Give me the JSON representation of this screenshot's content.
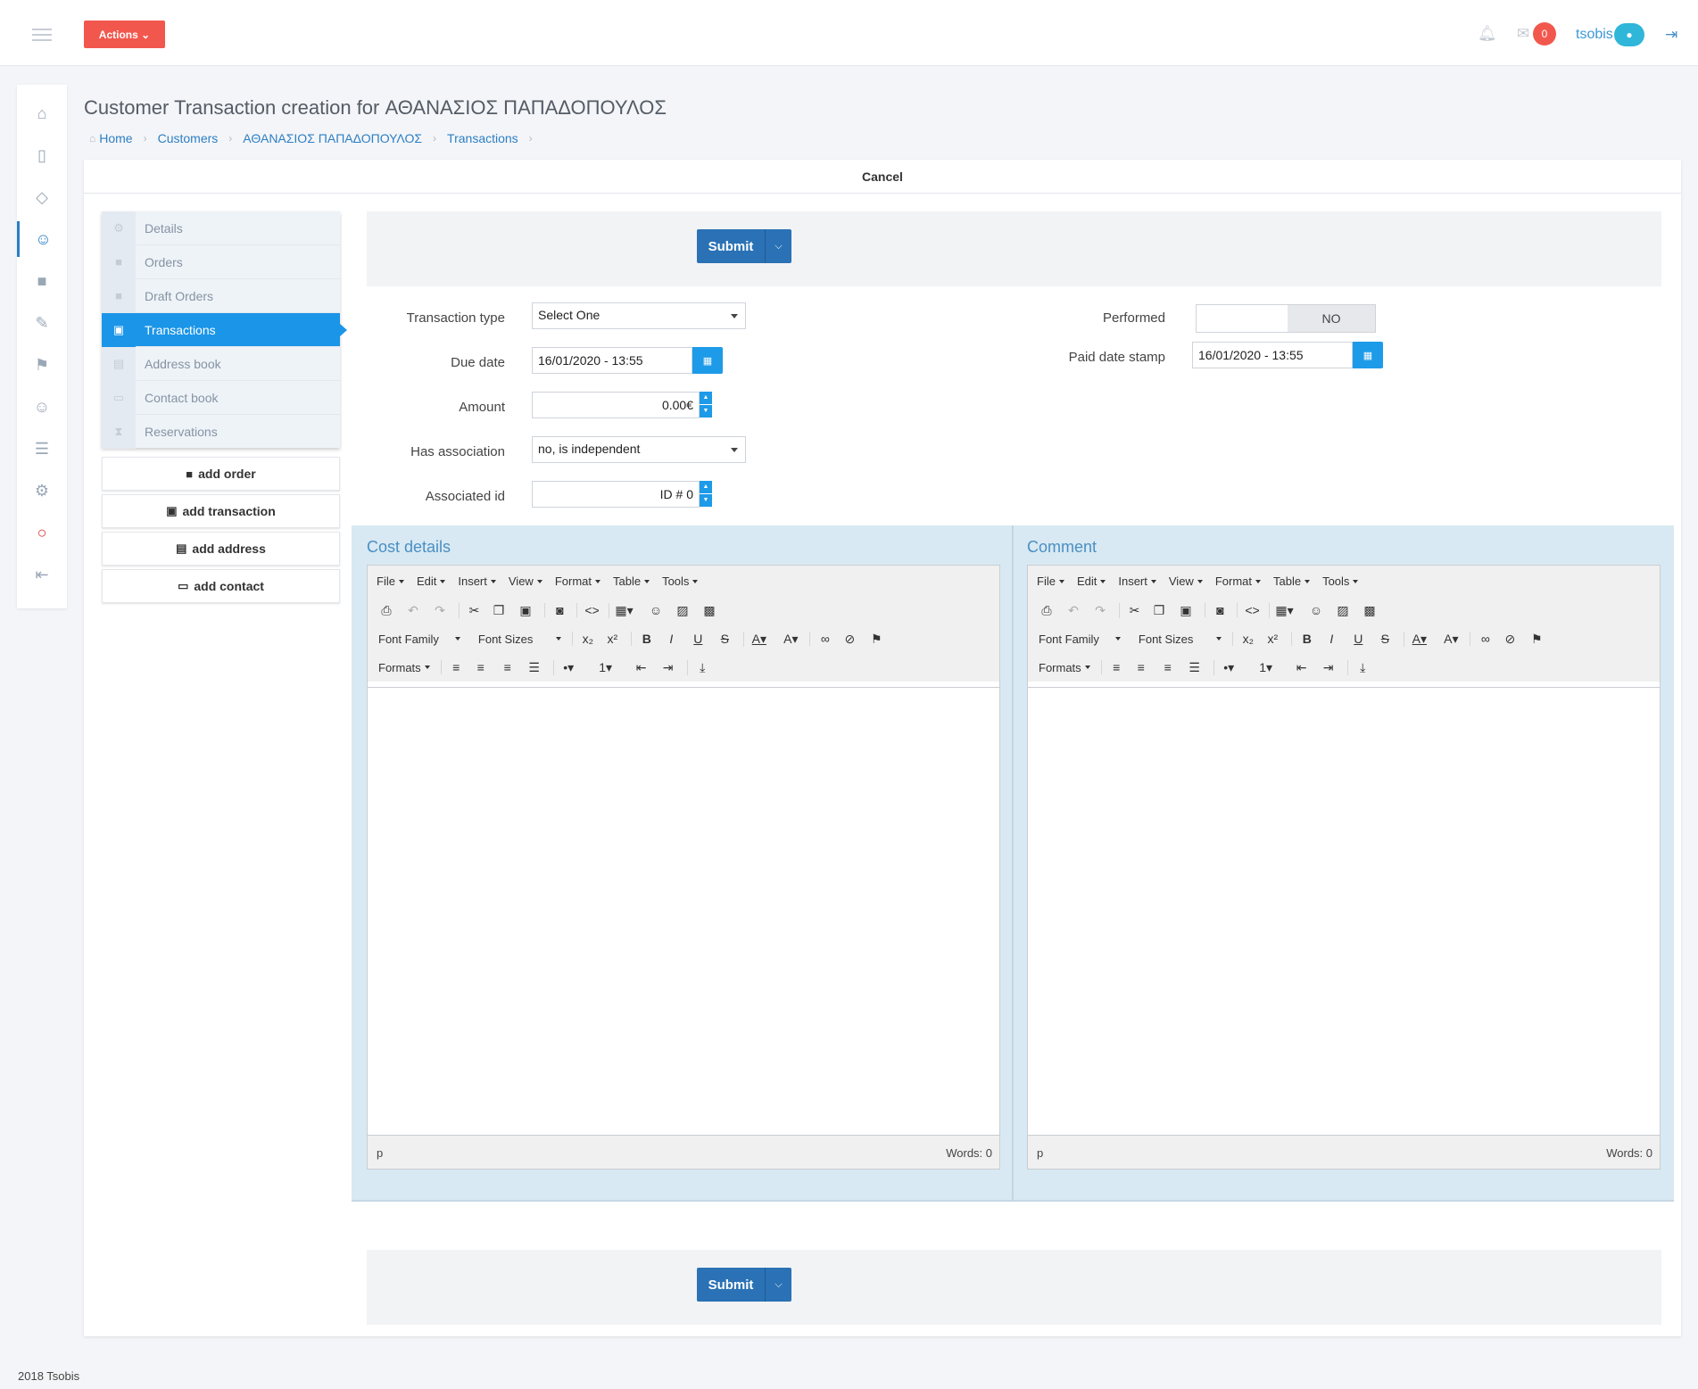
{
  "topbar": {
    "actions_label": "Actions ⌄",
    "mail_count": "0",
    "username": "tsobis",
    "icons": [
      "menu-icon",
      "bell-icon",
      "mail-icon",
      "user-icon",
      "logout-icon"
    ]
  },
  "rail": {
    "items": [
      "home-icon",
      "book-icon",
      "layers-icon",
      "customers-icon",
      "cart-icon",
      "edit-icon",
      "signpost-icon",
      "user-icon",
      "reader-icon",
      "settings-icon",
      "bulb-icon",
      "exit-icon"
    ]
  },
  "page": {
    "title": "Customer Transaction creation for ΑΘΑΝΑΣΙΟΣ ΠΑΠΑΔΟΠΟΥΛΟΣ",
    "breadcrumb": [
      "Home",
      "Customers",
      "ΑΘΑΝΑΣΙΟΣ ΠΑΠΑΔΟΠΟΥΛΟΣ",
      "Transactions"
    ],
    "cancel_label": "Cancel"
  },
  "side_menu": {
    "items": [
      "Details",
      "Orders",
      "Draft Orders",
      "Transactions",
      "Address book",
      "Contact book",
      "Reservations"
    ],
    "active": "Transactions"
  },
  "add_buttons": {
    "order": "add order",
    "transaction": "add transaction",
    "address": "add address",
    "contact": "add contact"
  },
  "submit": {
    "label": "Submit"
  },
  "form": {
    "transaction_type_label": "Transaction type",
    "transaction_type_value": "Select One",
    "due_date_label": "Due date",
    "due_date_value": "16/01/2020 - 13:55",
    "amount_label": "Amount",
    "amount_value": "0.00€",
    "has_association_label": "Has association",
    "has_association_value": "no, is independent",
    "associated_id_label": "Associated id",
    "associated_id_value": "ID # 0",
    "performed_label": "Performed",
    "performed_value": "NO",
    "paid_date_label": "Paid date stamp",
    "paid_date_value": "16/01/2020 - 13:55"
  },
  "editors": {
    "cost_title": "Cost details",
    "comment_title": "Comment",
    "menus": [
      "File",
      "Edit",
      "Insert",
      "View",
      "Format",
      "Table",
      "Tools"
    ],
    "font_family": "Font Family",
    "font_sizes": "Font Sizes",
    "formats": "Formats",
    "status_path": "p",
    "status_words": "Words: 0"
  },
  "footer": {
    "text": "2018 Tsobis"
  }
}
